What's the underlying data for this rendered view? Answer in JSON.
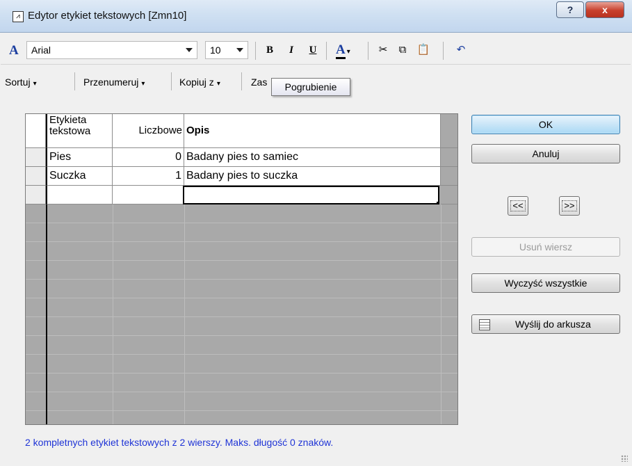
{
  "window": {
    "title": "Edytor etykiet tekstowych [Zmn10]",
    "help_label": "?",
    "close_label": "x"
  },
  "format_toolbar": {
    "font_name": "Arial",
    "font_size": "10",
    "bold": "B",
    "italic": "I",
    "underline": "U",
    "font_color": "A",
    "font_color_hex": "#1c3fa0"
  },
  "menu": {
    "sort_label": "Sortuj",
    "renumber_label": "Przenumeruj",
    "copy_from_label": "Kopiuj z",
    "replace_label_partial": "Zas"
  },
  "tooltip": "Pogrubienie",
  "table": {
    "headers": [
      "Etykieta tekstowa",
      "Liczbowe",
      "Opis"
    ],
    "rows": [
      [
        "Pies",
        "0",
        "Badany pies to samiec"
      ],
      [
        "Suczka",
        "1",
        "Badany pies to suczka"
      ]
    ]
  },
  "buttons": {
    "ok": "OK",
    "cancel": "Anuluj",
    "prev": "<<",
    "next": ">>",
    "delete_row": "Usuń wiersz",
    "clear_all": "Wyczyść wszystkie",
    "send_to_sheet": "Wyślij do arkusza"
  },
  "status": "2 kompletnych etykiet tekstowych z 2 wierszy. Maks. długość 0 znaków."
}
